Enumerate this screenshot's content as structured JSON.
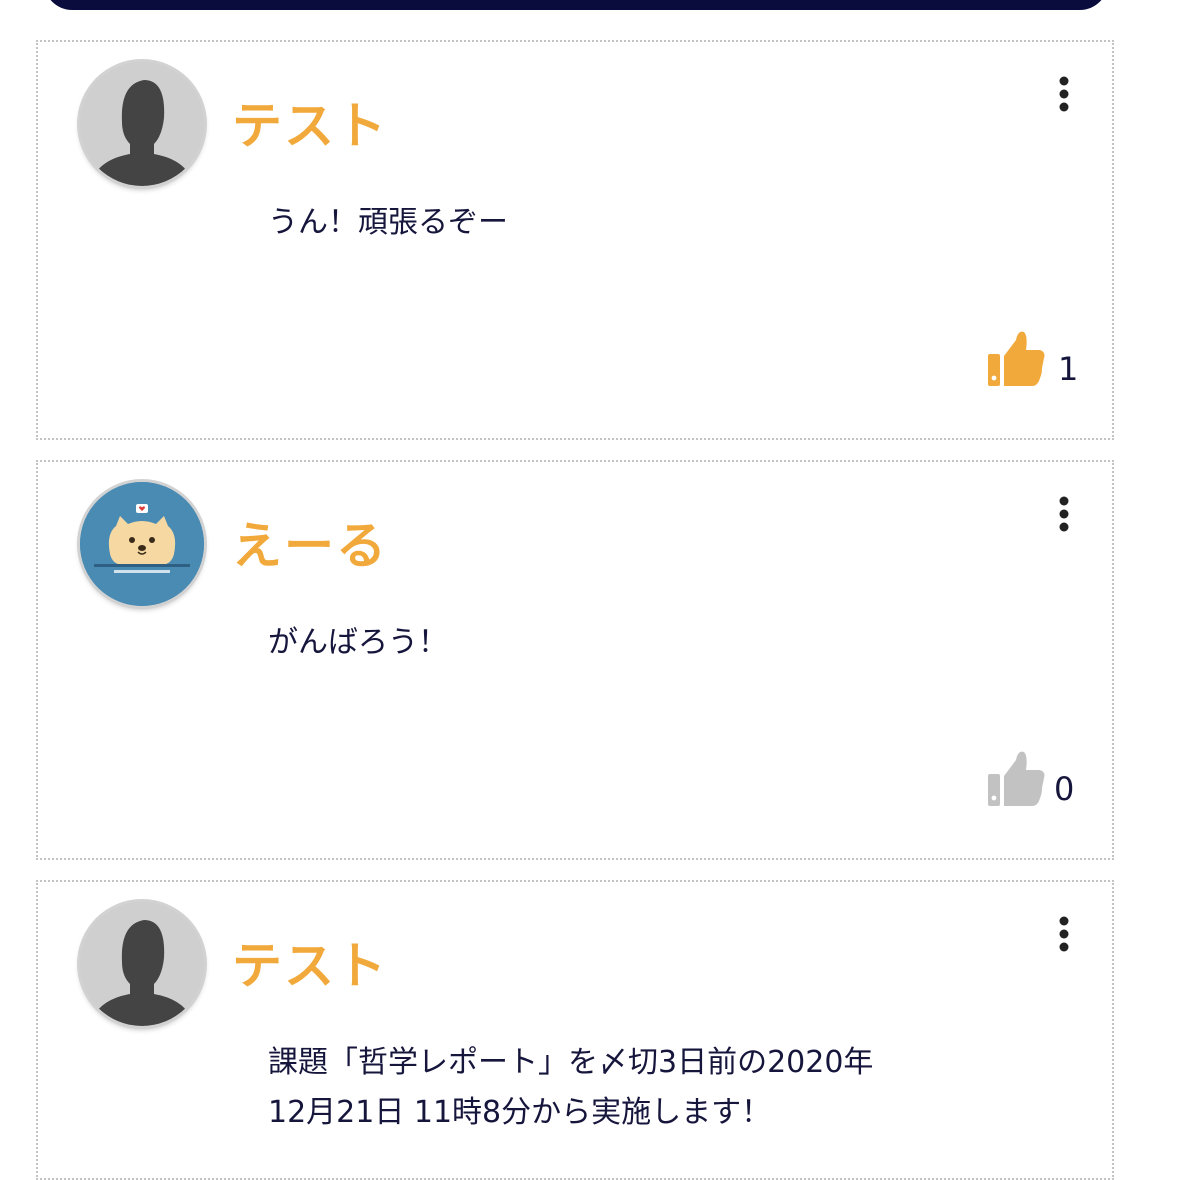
{
  "colors": {
    "username": "#f2a93b",
    "liked": "#f2a93b",
    "unliked": "#c2c2c2",
    "text": "#16163d",
    "header": "#0b0c3e"
  },
  "posts": [
    {
      "username": "テスト",
      "avatar": "default-avatar-icon",
      "content": "うん！頑張るぞー",
      "likes": "1",
      "liked": true
    },
    {
      "username": "えーる",
      "avatar": "pomeranian-avatar",
      "content": "がんばろう！",
      "likes": "0",
      "liked": false
    },
    {
      "username": "テスト",
      "avatar": "default-avatar-icon",
      "content": "課題「哲学レポート」を〆切3日前の2020年12月21日 11時8分から実施します！"
    }
  ]
}
